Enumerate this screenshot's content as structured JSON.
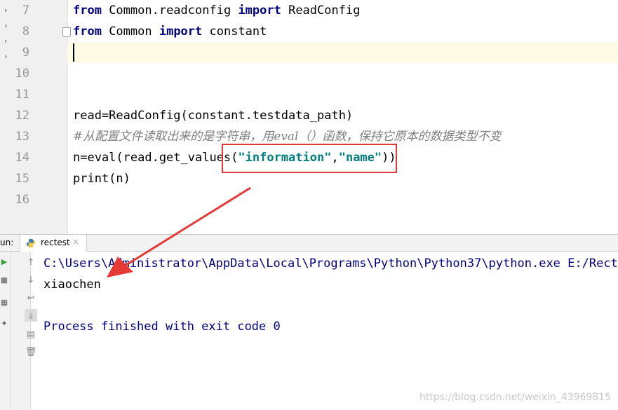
{
  "editor": {
    "lines": [
      {
        "num": "7",
        "kw1": "from",
        "mod": " Common.readconfig ",
        "kw2": "import",
        "name": " ReadConfig"
      },
      {
        "num": "8",
        "kw1": "from",
        "mod": " Common ",
        "kw2": "import",
        "name": " constant"
      },
      {
        "num": "9"
      },
      {
        "num": "10"
      },
      {
        "num": "11"
      },
      {
        "num": "12",
        "code": "read=ReadConfig(constant.testdata_path)"
      },
      {
        "num": "13",
        "comment": "#从配置文件读取出来的是字符串，用eval（）函数，保持它原本的数据类型不变"
      },
      {
        "num": "14",
        "pre": "n=eval(read.get_values(",
        "str1": "\"information\"",
        "comma": ",",
        "str2": "\"name\"",
        "post": "))"
      },
      {
        "num": "15",
        "code": "print(n)"
      },
      {
        "num": "16"
      }
    ]
  },
  "run_panel": {
    "label": "un:",
    "tab_label": "rectest",
    "tab_close": "×"
  },
  "console": {
    "command": "C:\\Users\\Administrator\\AppData\\Local\\Programs\\Python\\Python37\\python.exe E:/Rectes",
    "output": "xiaochen",
    "finish": "Process finished with exit code 0"
  },
  "toolbar_icons": [
    "rerun-icon",
    "scroll-up-icon",
    "scroll-down-icon",
    "soft-wrap-icon",
    "scroll-to-end-icon",
    "print-icon",
    "delete-icon"
  ],
  "colors": {
    "keyword": "#000080",
    "string": "#008080",
    "comment": "#808080",
    "annotation": "#e53935"
  },
  "watermark": "https://blog.csdn.net/weixin_43969815"
}
